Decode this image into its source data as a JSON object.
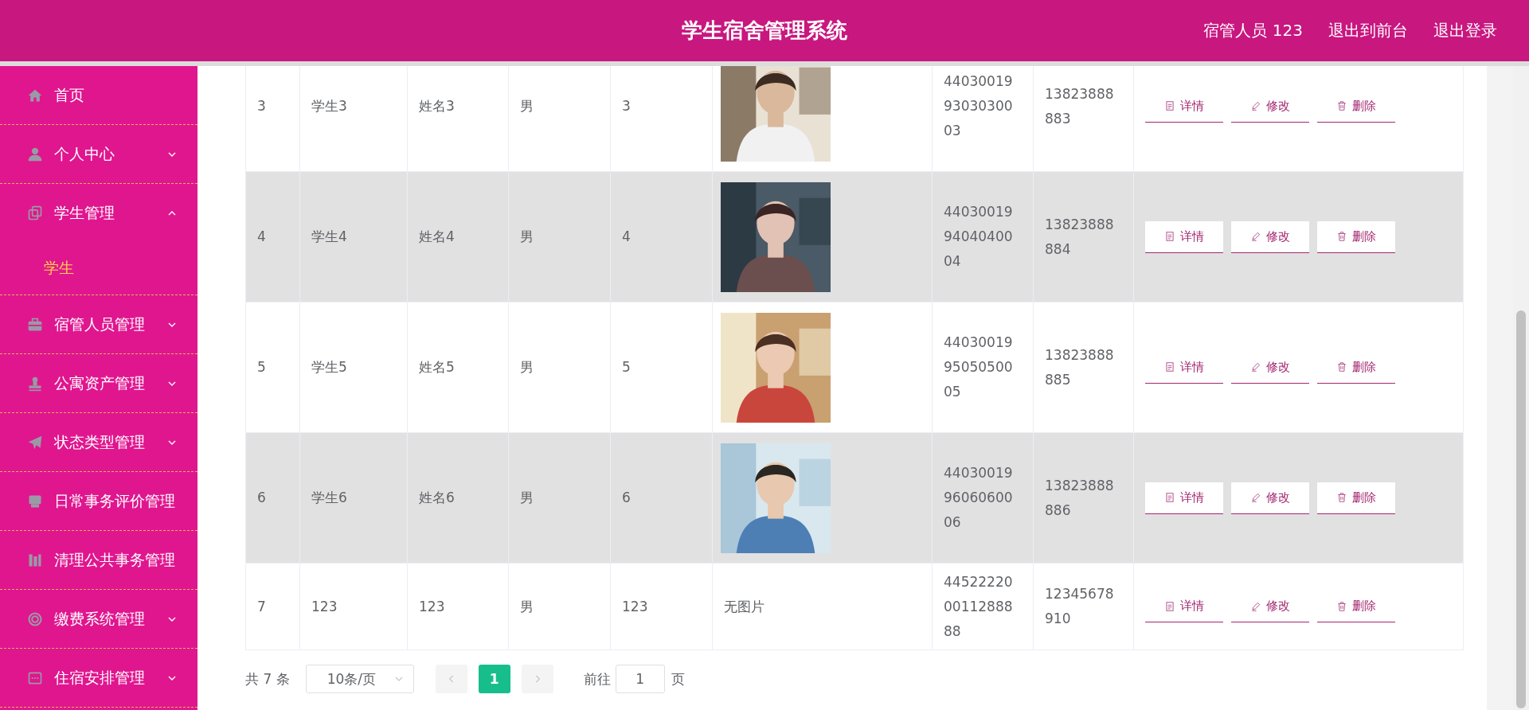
{
  "header": {
    "title": "学生宿舍管理系统",
    "user_label": "宿管人员 123",
    "links": [
      "退出到前台",
      "退出登录"
    ]
  },
  "sidebar": {
    "items": [
      {
        "label": "首页",
        "kind": "link"
      },
      {
        "label": "个人中心",
        "kind": "menu",
        "expanded": false
      },
      {
        "label": "学生管理",
        "kind": "menu",
        "expanded": true,
        "children": [
          {
            "label": "学生",
            "selected": true
          }
        ]
      },
      {
        "label": "宿管人员管理",
        "kind": "menu",
        "expanded": false
      },
      {
        "label": "公寓资产管理",
        "kind": "menu",
        "expanded": false
      },
      {
        "label": "状态类型管理",
        "kind": "menu",
        "expanded": false
      },
      {
        "label": "日常事务评价管理",
        "kind": "link"
      },
      {
        "label": "清理公共事务管理",
        "kind": "link"
      },
      {
        "label": "缴费系统管理",
        "kind": "menu",
        "expanded": false
      },
      {
        "label": "住宿安排管理",
        "kind": "menu",
        "expanded": false
      }
    ]
  },
  "table": {
    "rows": [
      {
        "cells": [
          {
            "kind": "text",
            "text": "3"
          },
          {
            "kind": "text",
            "text": "学生3"
          },
          {
            "kind": "text",
            "text": "姓名3"
          },
          {
            "kind": "text",
            "text": "男"
          },
          {
            "kind": "text",
            "text": "3"
          },
          {
            "kind": "picture"
          },
          {
            "kind": "text",
            "text": "44030019 93030300 03"
          },
          {
            "kind": "text",
            "text": "13823888 883"
          }
        ],
        "actions": [
          "详情",
          "修改",
          "删除"
        ]
      },
      {
        "cells": [
          {
            "kind": "text",
            "text": "4"
          },
          {
            "kind": "text",
            "text": "学生4"
          },
          {
            "kind": "text",
            "text": "姓名4"
          },
          {
            "kind": "text",
            "text": "男"
          },
          {
            "kind": "text",
            "text": "4"
          },
          {
            "kind": "picture"
          },
          {
            "kind": "text",
            "text": "44030019 94040400 04"
          },
          {
            "kind": "text",
            "text": "13823888 884"
          }
        ],
        "actions": [
          "详情",
          "修改",
          "删除"
        ]
      },
      {
        "cells": [
          {
            "kind": "text",
            "text": "5"
          },
          {
            "kind": "text",
            "text": "学生5"
          },
          {
            "kind": "text",
            "text": "姓名5"
          },
          {
            "kind": "text",
            "text": "男"
          },
          {
            "kind": "text",
            "text": "5"
          },
          {
            "kind": "picture"
          },
          {
            "kind": "text",
            "text": "44030019 95050500 05"
          },
          {
            "kind": "text",
            "text": "13823888 885"
          }
        ],
        "actions": [
          "详情",
          "修改",
          "删除"
        ]
      },
      {
        "cells": [
          {
            "kind": "text",
            "text": "6"
          },
          {
            "kind": "text",
            "text": "学生6"
          },
          {
            "kind": "text",
            "text": "姓名6"
          },
          {
            "kind": "text",
            "text": "男"
          },
          {
            "kind": "text",
            "text": "6"
          },
          {
            "kind": "picture"
          },
          {
            "kind": "text",
            "text": "44030019 96060600 06"
          },
          {
            "kind": "text",
            "text": "13823888 886"
          }
        ],
        "actions": [
          "详情",
          "修改",
          "删除"
        ]
      },
      {
        "cells": [
          {
            "kind": "text",
            "text": "7"
          },
          {
            "kind": "text",
            "text": "123"
          },
          {
            "kind": "text",
            "text": "123"
          },
          {
            "kind": "text",
            "text": "男"
          },
          {
            "kind": "text",
            "text": "123"
          },
          {
            "kind": "text",
            "text": "无图片"
          },
          {
            "kind": "text",
            "text": "44522220 00112888 88"
          },
          {
            "kind": "text",
            "text": "12345678 910"
          }
        ],
        "actions": [
          "详情",
          "修改",
          "删除"
        ]
      }
    ]
  },
  "pagination": {
    "total": "共 7 条",
    "page_size": "10条/页",
    "pages": [
      {
        "label": "1",
        "selected": true
      }
    ],
    "goto_label": "前往",
    "goto_value": "1",
    "goto_suffix": "页"
  }
}
